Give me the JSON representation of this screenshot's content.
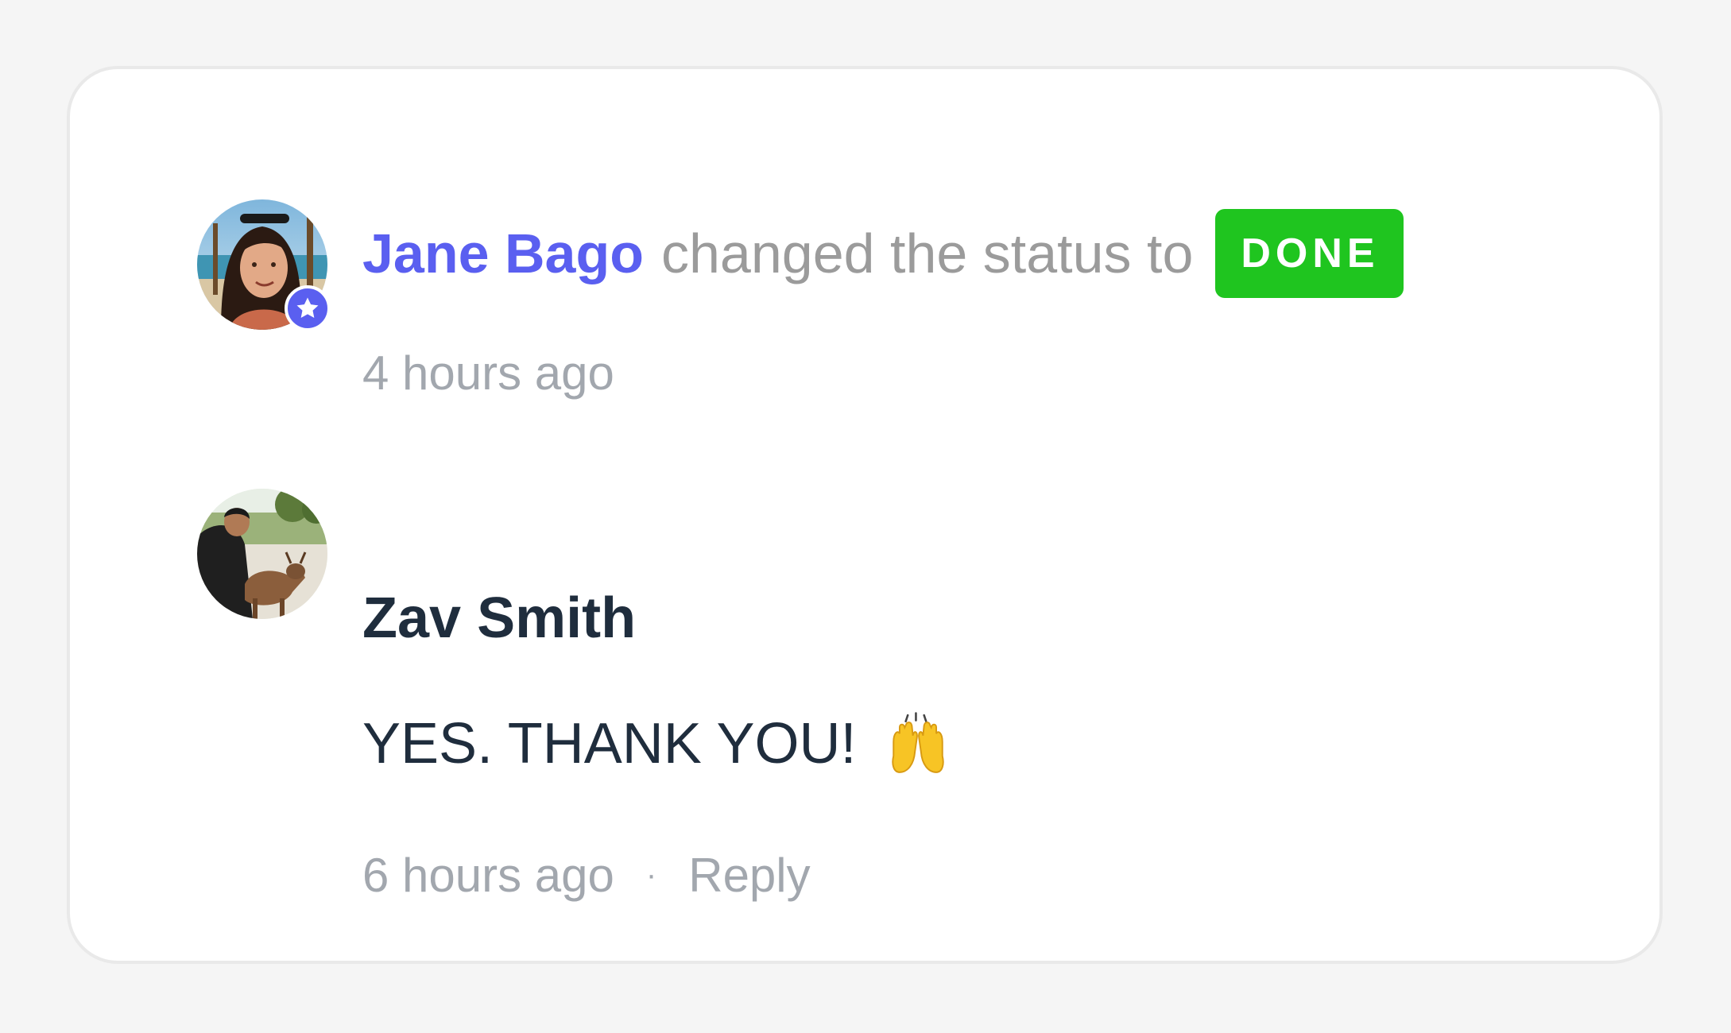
{
  "activity": {
    "status_change": {
      "author": "Jane Bago",
      "action": "changed the status to",
      "status": "DONE",
      "time": "4 hours ago"
    },
    "comment": {
      "author": "Zav Smith",
      "message": "YES. THANK YOU!",
      "emoji": "raising-hands-emoji",
      "time": "6 hours ago",
      "separator": "·",
      "reply_label": "Reply"
    }
  },
  "colors": {
    "accent": "#5a5ff0",
    "status_done": "#1fc51f",
    "muted_text": "#a2a7ae",
    "action_text": "#9b9b9b",
    "primary_text": "#1f2d3d",
    "page_background": "#f5f5f5",
    "card_background": "#ffffff"
  },
  "icons": {
    "owner_badge": "star-icon"
  }
}
